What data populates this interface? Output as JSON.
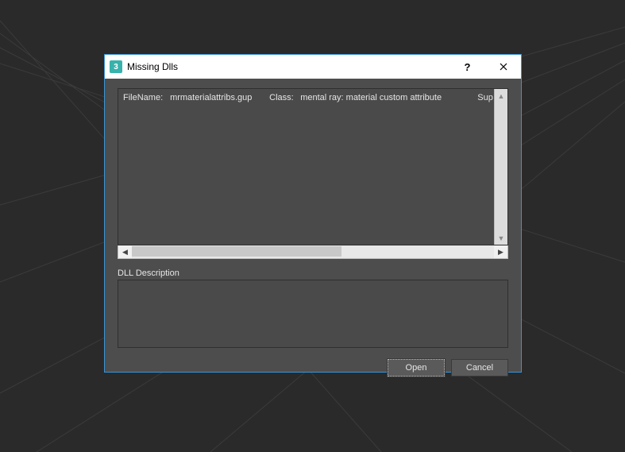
{
  "dialog": {
    "title": "Missing Dlls",
    "icon_text": "3"
  },
  "list": {
    "rows": [
      {
        "file_label": "FileName:",
        "file_value": "mrmaterialattribs.gup",
        "class_label": "Class:",
        "class_value": "mental ray: material custom attribute",
        "trailing": "Sup"
      }
    ]
  },
  "description": {
    "label": "DLL Description"
  },
  "buttons": {
    "open": "Open",
    "cancel": "Cancel"
  }
}
